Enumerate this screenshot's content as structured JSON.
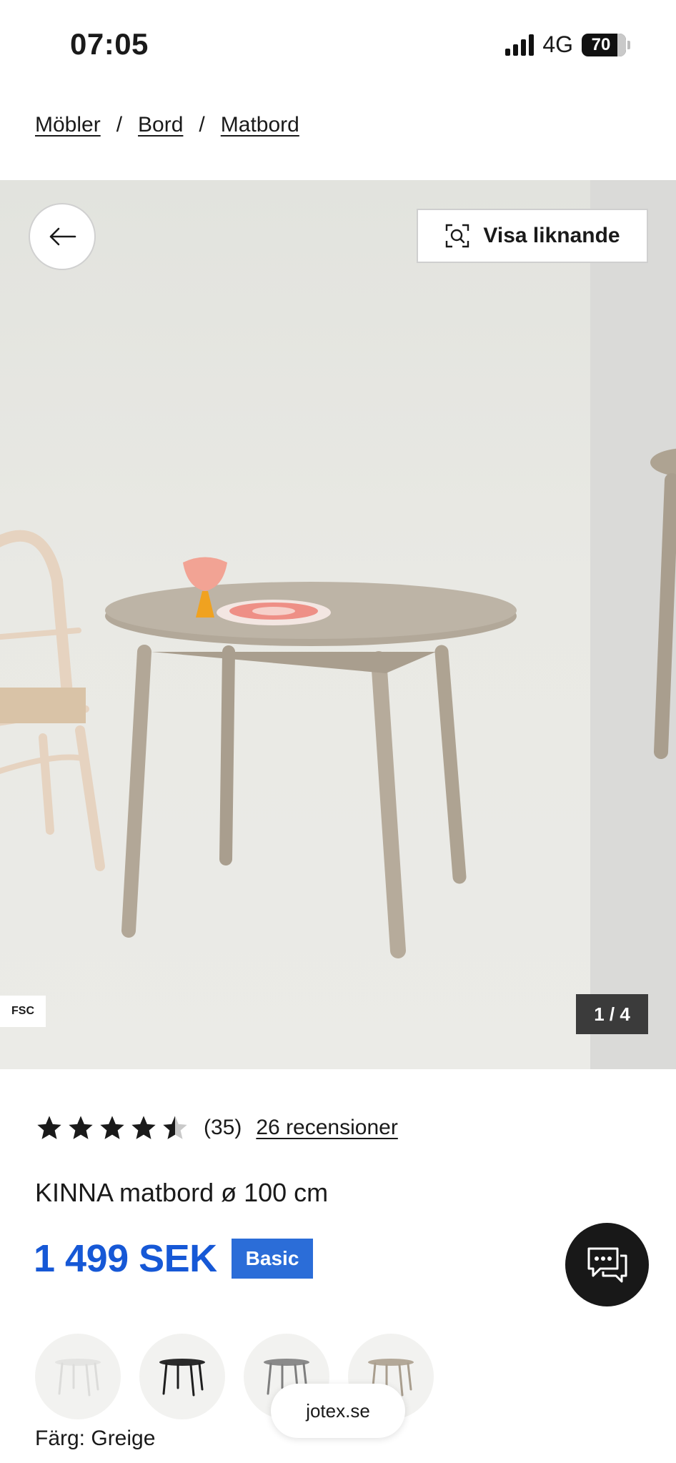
{
  "status_bar": {
    "time": "07:05",
    "network": "4G",
    "battery": "70"
  },
  "breadcrumb": {
    "items": [
      "Möbler",
      "Bord",
      "Matbord"
    ],
    "separator": "/"
  },
  "gallery": {
    "similar_button_label": "Visa liknande",
    "fsc_label": "FSC",
    "counter": "1 / 4",
    "colors": {
      "table": "#b5aa9c",
      "chair": "#e8d6c3",
      "background": "#e6e6e1"
    }
  },
  "product": {
    "rating_value": 4.5,
    "rating_count": "(35)",
    "reviews_link": "26 recensioner",
    "title": "KINNA matbord ø 100 cm",
    "price": "1 499 SEK",
    "badge": "Basic",
    "color_label": "Färg: Greige",
    "swatches": [
      "white-table",
      "black-table",
      "grey-table",
      "greige-table"
    ]
  },
  "browser": {
    "domain": "jotex.se"
  },
  "icons": {
    "back": "arrow-left-icon",
    "similar": "visual-search-icon",
    "chat": "chat-icon",
    "star": "star-icon"
  },
  "theme": {
    "price_color": "#1658d6",
    "badge_color": "#2b6dd8",
    "chat_button_color": "#181818"
  }
}
